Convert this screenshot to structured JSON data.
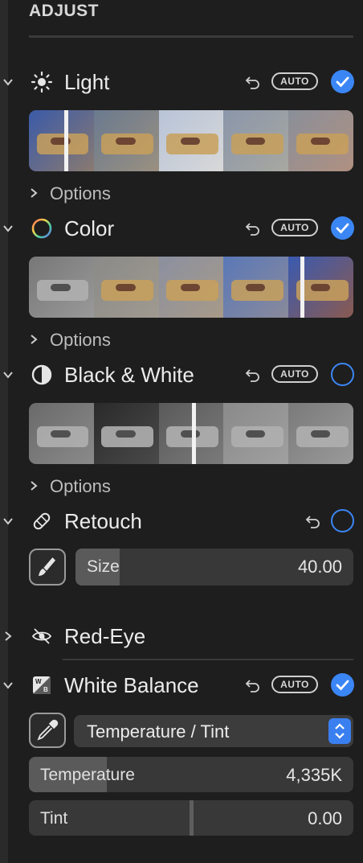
{
  "header": {
    "title": "ADJUST"
  },
  "sections": {
    "light": {
      "title": "Light",
      "auto_label": "AUTO",
      "enabled": true,
      "options_label": "Options",
      "icon": "sun-icon"
    },
    "color": {
      "title": "Color",
      "auto_label": "AUTO",
      "enabled": true,
      "options_label": "Options",
      "icon": "color-wheel-icon"
    },
    "bw": {
      "title": "Black & White",
      "auto_label": "AUTO",
      "enabled": false,
      "options_label": "Options",
      "icon": "half-circle-icon"
    },
    "retouch": {
      "title": "Retouch",
      "enabled": false,
      "icon": "bandage-icon",
      "size_label": "Size",
      "size_value": "40.00",
      "size_fill": 0.16
    },
    "redeye": {
      "title": "Red-Eye",
      "icon": "eye-slash-icon"
    },
    "white_balance": {
      "title": "White Balance",
      "auto_label": "AUTO",
      "enabled": true,
      "icon": "white-balance-icon",
      "mode_value": "Temperature / Tint",
      "temperature_label": "Temperature",
      "temperature_value": "4,335K",
      "temperature_fill": 0.24,
      "tint_label": "Tint",
      "tint_value": "0.00",
      "tint_position": 0.5
    }
  },
  "colors": {
    "accent": "#3b86f5",
    "panel": "#1e1e1e",
    "slider": "#383838"
  }
}
